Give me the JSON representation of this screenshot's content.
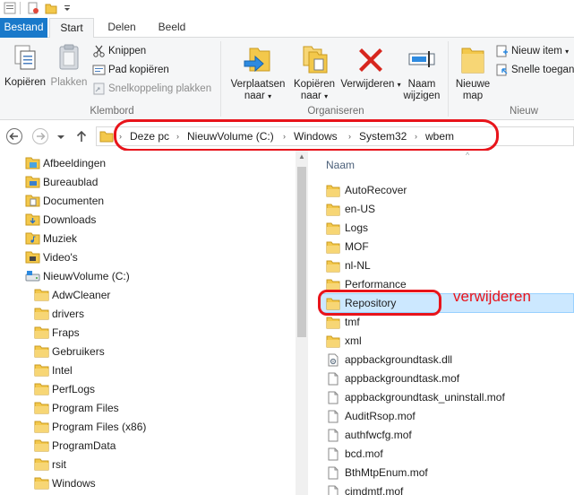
{
  "ribbon": {
    "tabs": [
      {
        "label": "Bestand"
      },
      {
        "label": "Start"
      },
      {
        "label": "Delen"
      },
      {
        "label": "Beeld"
      }
    ],
    "groups": {
      "clipboard": {
        "label": "Klembord",
        "copy": "Kopiëren",
        "paste": "Plakken",
        "cut": "Knippen",
        "copy_path": "Pad kopiëren",
        "paste_shortcut": "Snelkoppeling plakken"
      },
      "organize": {
        "label": "Organiseren",
        "move_to_line1": "Verplaatsen",
        "move_to_line2": "naar",
        "copy_to_line1": "Kopiëren",
        "copy_to_line2": "naar",
        "delete": "Verwijderen",
        "rename_line1": "Naam",
        "rename_line2": "wijzigen"
      },
      "new": {
        "label": "Nieuw",
        "new_folder_line1": "Nieuwe",
        "new_folder_line2": "map",
        "new_item": "Nieuw item",
        "easy_access": "Snelle toegang"
      }
    }
  },
  "address": {
    "crumbs": [
      "Deze pc",
      "NieuwVolume (C:)",
      "Windows",
      "System32",
      "wbem"
    ]
  },
  "nav_pane": {
    "items": [
      {
        "label": "Afbeeldingen",
        "level": 1,
        "icon": "pictures-icon"
      },
      {
        "label": "Bureaublad",
        "level": 1,
        "icon": "desktop-icon"
      },
      {
        "label": "Documenten",
        "level": 1,
        "icon": "documents-icon"
      },
      {
        "label": "Downloads",
        "level": 1,
        "icon": "downloads-icon"
      },
      {
        "label": "Muziek",
        "level": 1,
        "icon": "music-icon"
      },
      {
        "label": "Video's",
        "level": 1,
        "icon": "videos-icon"
      },
      {
        "label": "NieuwVolume (C:)",
        "level": 1,
        "icon": "drive-icon"
      },
      {
        "label": "AdwCleaner",
        "level": 2,
        "icon": "folder-icon"
      },
      {
        "label": "drivers",
        "level": 2,
        "icon": "folder-icon"
      },
      {
        "label": "Fraps",
        "level": 2,
        "icon": "folder-icon"
      },
      {
        "label": "Gebruikers",
        "level": 2,
        "icon": "folder-icon"
      },
      {
        "label": "Intel",
        "level": 2,
        "icon": "folder-icon"
      },
      {
        "label": "PerfLogs",
        "level": 2,
        "icon": "folder-icon"
      },
      {
        "label": "Program Files",
        "level": 2,
        "icon": "folder-icon"
      },
      {
        "label": "Program Files (x86)",
        "level": 2,
        "icon": "folder-icon"
      },
      {
        "label": "ProgramData",
        "level": 2,
        "icon": "folder-icon"
      },
      {
        "label": "rsit",
        "level": 2,
        "icon": "folder-icon"
      },
      {
        "label": "Windows",
        "level": 2,
        "icon": "folder-icon"
      }
    ]
  },
  "file_list": {
    "column_name": "Naam",
    "items": [
      {
        "name": "AutoRecover",
        "type": "folder"
      },
      {
        "name": "en-US",
        "type": "folder"
      },
      {
        "name": "Logs",
        "type": "folder"
      },
      {
        "name": "MOF",
        "type": "folder"
      },
      {
        "name": "nl-NL",
        "type": "folder"
      },
      {
        "name": "Performance",
        "type": "folder"
      },
      {
        "name": "Repository",
        "type": "folder",
        "selected": true
      },
      {
        "name": "tmf",
        "type": "folder"
      },
      {
        "name": "xml",
        "type": "folder"
      },
      {
        "name": "appbackgroundtask.dll",
        "type": "dll"
      },
      {
        "name": "appbackgroundtask.mof",
        "type": "file"
      },
      {
        "name": "appbackgroundtask_uninstall.mof",
        "type": "file"
      },
      {
        "name": "AuditRsop.mof",
        "type": "file"
      },
      {
        "name": "authfwcfg.mof",
        "type": "file"
      },
      {
        "name": "bcd.mof",
        "type": "file"
      },
      {
        "name": "BthMtpEnum.mof",
        "type": "file"
      },
      {
        "name": "cimdmtf.mof",
        "type": "file"
      }
    ]
  },
  "annotation": {
    "text": "verwijderen",
    "color": "#e8141b"
  },
  "colors": {
    "accent": "#1979ca",
    "folder": "#f3c84b",
    "selection": "#cce8ff"
  }
}
